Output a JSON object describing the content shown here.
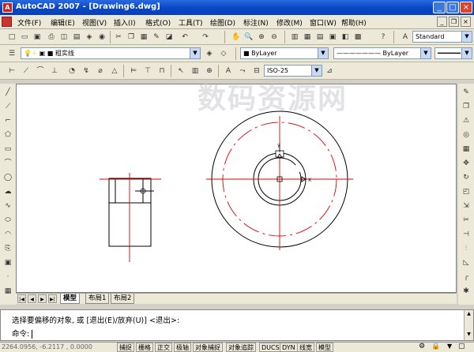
{
  "window": {
    "title": "AutoCAD 2007 - [Drawing6.dwg]",
    "app_icon": "A"
  },
  "menu": [
    "文件(F)",
    "编辑(E)",
    "视图(V)",
    "插入(I)",
    "格式(O)",
    "工具(T)",
    "绘图(D)",
    "标注(N)",
    "修改(M)",
    "窗口(W)",
    "帮助(H)"
  ],
  "toolbar": {
    "text_style": "Standard",
    "layer": "粗实线",
    "color": "ByLayer",
    "linetype": "ByLayer",
    "dim_style": "ISO-25"
  },
  "tabs": [
    "模型",
    "布局1",
    "布局2"
  ],
  "command": {
    "history": "选择要偏移的对象, 或 [退出(E)/放弃(U)] <退出>:",
    "prompt": "命令:"
  },
  "status": {
    "coords": "2264.0956, -6.2117 , 0.0000",
    "buttons": [
      "捕捉",
      "栅格",
      "正交",
      "极轴",
      "对象捕捉",
      "对象追踪",
      "DUCS",
      "DYN",
      "线宽",
      "模型"
    ]
  },
  "watermark": "数码资源网",
  "colors": {
    "accent_red": "#e00000",
    "title_blue": "#0a48c8"
  }
}
